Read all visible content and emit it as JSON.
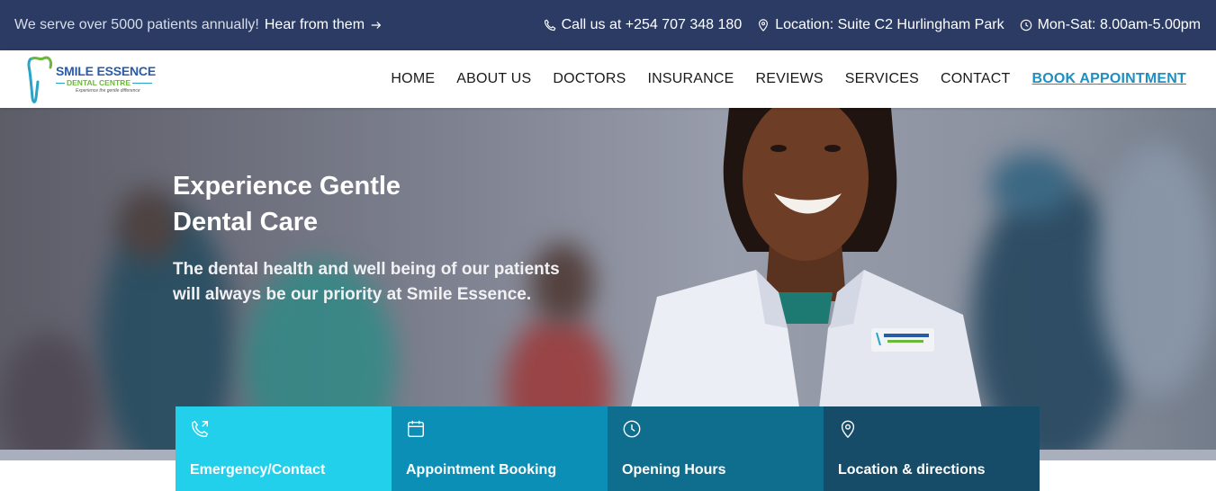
{
  "topbar": {
    "intro": "We serve over 5000 patients annually!",
    "link": "Hear from them",
    "phone": "Call us at +254 707 348 180",
    "location": "Location: Suite C2 Hurlingham Park",
    "hours": "Mon-Sat: 8.00am-5.00pm",
    "background": "#2b3b63"
  },
  "logo": {
    "name": "SMILE ESSENCE",
    "sub": "DENTAL CENTRE",
    "tagline": "Experience the gentle difference"
  },
  "nav": {
    "items": [
      "HOME",
      "ABOUT US",
      "DOCTORS",
      "INSURANCE",
      "REVIEWS",
      "SERVICES",
      "CONTACT"
    ],
    "cta": "BOOK APPOINTMENT",
    "cta_color": "#1f8ec0"
  },
  "hero": {
    "title_line1": "Experience Gentle",
    "title_line2": "Dental Care",
    "subtitle_line1": "The dental health and well being of our patients",
    "subtitle_line2": "will always be our priority at Smile Essence."
  },
  "cards": [
    {
      "label": "Emergency/Contact",
      "icon": "phone-call-icon",
      "color": "#22d0ec"
    },
    {
      "label": "Appointment Booking",
      "icon": "calendar-icon",
      "color": "#0c8fb7"
    },
    {
      "label": "Opening Hours",
      "icon": "clock-icon",
      "color": "#0f6e8e"
    },
    {
      "label": "Location & directions",
      "icon": "map-pin-icon",
      "color": "#164c67"
    }
  ]
}
